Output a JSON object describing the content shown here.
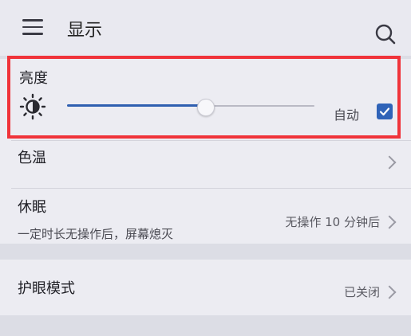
{
  "header": {
    "title": "显示"
  },
  "brightness": {
    "label": "亮度",
    "auto_label": "自动",
    "level": 0.52,
    "auto_checked": true
  },
  "items": [
    {
      "label": "色温",
      "sublabel": "",
      "value": ""
    },
    {
      "label": "休眠",
      "sublabel": "一定时长无操作后，屏幕熄灭",
      "value": "无操作 10 分钟后"
    },
    {
      "label": "护眼模式",
      "sublabel": "",
      "value": "已关闭"
    }
  ],
  "colors": {
    "highlight": "#f0333a",
    "accent": "#2f63b8"
  },
  "icons": [
    "menu-icon",
    "search-icon",
    "brightness-icon",
    "checkmark-icon",
    "chevron-right-icon"
  ]
}
